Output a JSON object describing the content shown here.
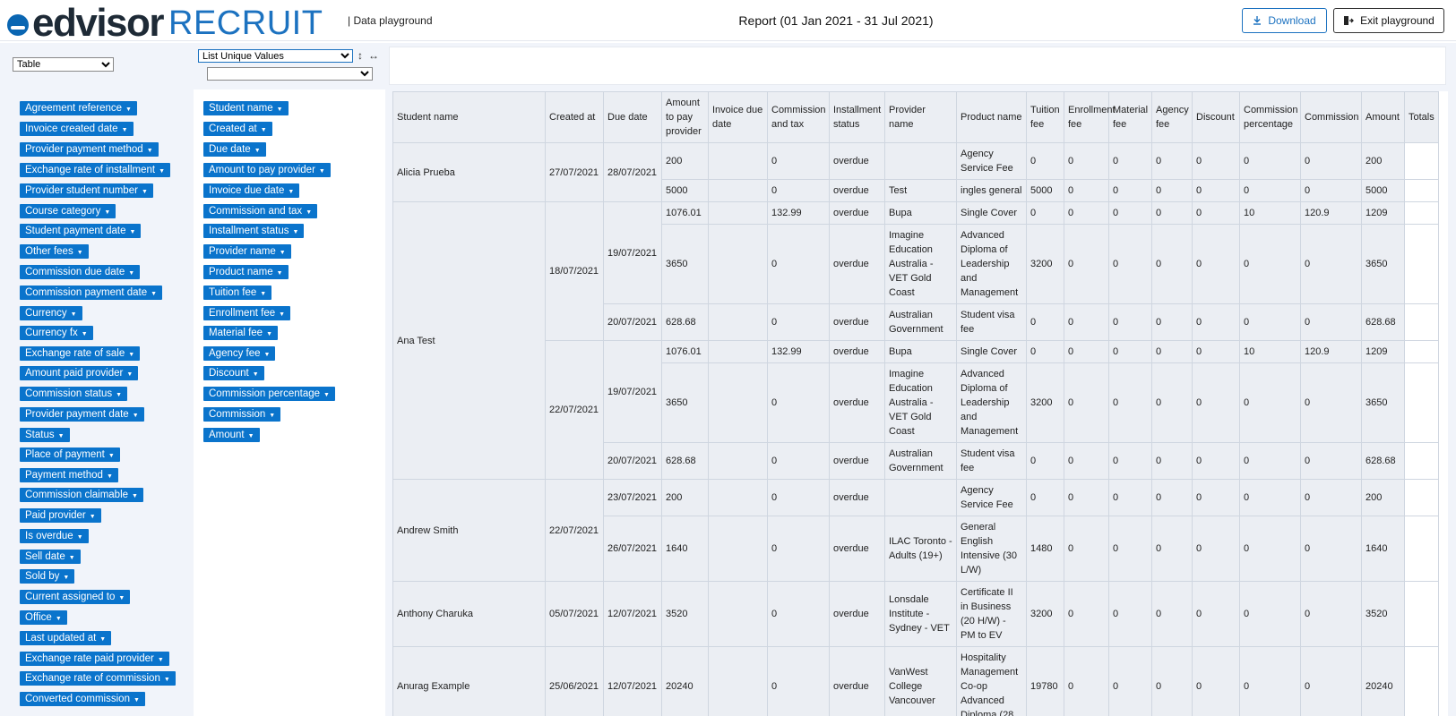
{
  "header": {
    "logo_word": "edvisor",
    "logo_recruit": "RECRUIT",
    "subtitle": "| Data playground",
    "report_title": "Report (01 Jan 2021 - 31 Jul 2021)",
    "download_label": "Download",
    "exit_label": "Exit playground"
  },
  "controls": {
    "renderer": "Table",
    "aggregator": "List Unique Values",
    "attribute": "",
    "sort_rows_icon": "↕",
    "sort_cols_icon": "↔"
  },
  "unused_attributes": [
    "Agreement reference",
    "Invoice created date",
    "Provider payment method",
    "Exchange rate of installment",
    "Provider student number",
    "Course category",
    "Student payment date",
    "Other fees",
    "Commission due date",
    "Commission payment date",
    "Currency",
    "Currency fx",
    "Exchange rate of sale",
    "Amount paid provider",
    "Commission status",
    "Provider payment date",
    "Status",
    "Place of payment",
    "Payment method",
    "Commission claimable",
    "Paid provider",
    "Is overdue",
    "Sell date",
    "Sold by",
    "Current assigned to",
    "Office",
    "Last updated at",
    "Exchange rate paid provider",
    "Exchange rate of commission",
    "Converted commission"
  ],
  "row_attributes": [
    "Student name",
    "Created at",
    "Due date",
    "Amount to pay provider",
    "Invoice due date",
    "Commission and tax",
    "Installment status",
    "Provider name",
    "Product name",
    "Tuition fee",
    "Enrollment fee",
    "Material fee",
    "Agency fee",
    "Discount",
    "Commission percentage",
    "Commission",
    "Amount"
  ],
  "table": {
    "headers": [
      "Student name",
      "Created at",
      "Due date",
      "Amount to pay provider",
      "Invoice due date",
      "Commission and tax",
      "Installment status",
      "Provider name",
      "Product name",
      "Tuition fee",
      "Enrollment fee",
      "Material fee",
      "Agency fee",
      "Discount",
      "Commission percentage",
      "Commission",
      "Amount",
      "Totals"
    ],
    "students": [
      {
        "name": "Alicia Prueba",
        "groups": [
          {
            "created": "27/07/2021",
            "dues": [
              {
                "due": "28/07/2021",
                "rows": [
                  [
                    "200",
                    "",
                    "0",
                    "overdue",
                    "",
                    "Agency Service Fee",
                    "0",
                    "0",
                    "0",
                    "0",
                    "0",
                    "0",
                    "0",
                    "200"
                  ],
                  [
                    "5000",
                    "",
                    "0",
                    "overdue",
                    "Test",
                    "ingles general",
                    "5000",
                    "0",
                    "0",
                    "0",
                    "0",
                    "0",
                    "0",
                    "5000"
                  ]
                ]
              }
            ]
          }
        ]
      },
      {
        "name": "Ana Test",
        "groups": [
          {
            "created": "18/07/2021",
            "dues": [
              {
                "due": "19/07/2021",
                "rows": [
                  [
                    "1076.01",
                    "",
                    "132.99",
                    "overdue",
                    "Bupa",
                    "Single Cover",
                    "0",
                    "0",
                    "0",
                    "0",
                    "0",
                    "10",
                    "120.9",
                    "1209"
                  ],
                  [
                    "3650",
                    "",
                    "0",
                    "overdue",
                    "Imagine Education Australia - VET Gold Coast",
                    "Advanced Diploma of Leadership and Management",
                    "3200",
                    "0",
                    "0",
                    "0",
                    "0",
                    "0",
                    "0",
                    "3650"
                  ]
                ]
              },
              {
                "due": "20/07/2021",
                "rows": [
                  [
                    "628.68",
                    "",
                    "0",
                    "overdue",
                    "Australian Government",
                    "Student visa fee",
                    "0",
                    "0",
                    "0",
                    "0",
                    "0",
                    "0",
                    "0",
                    "628.68"
                  ]
                ]
              }
            ]
          },
          {
            "created": "22/07/2021",
            "dues": [
              {
                "due": "19/07/2021",
                "rows": [
                  [
                    "1076.01",
                    "",
                    "132.99",
                    "overdue",
                    "Bupa",
                    "Single Cover",
                    "0",
                    "0",
                    "0",
                    "0",
                    "0",
                    "10",
                    "120.9",
                    "1209"
                  ],
                  [
                    "3650",
                    "",
                    "0",
                    "overdue",
                    "Imagine Education Australia - VET Gold Coast",
                    "Advanced Diploma of Leadership and Management",
                    "3200",
                    "0",
                    "0",
                    "0",
                    "0",
                    "0",
                    "0",
                    "3650"
                  ]
                ]
              },
              {
                "due": "20/07/2021",
                "rows": [
                  [
                    "628.68",
                    "",
                    "0",
                    "overdue",
                    "Australian Government",
                    "Student visa fee",
                    "0",
                    "0",
                    "0",
                    "0",
                    "0",
                    "0",
                    "0",
                    "628.68"
                  ]
                ]
              }
            ]
          }
        ]
      },
      {
        "name": "Andrew Smith",
        "groups": [
          {
            "created": "22/07/2021",
            "dues": [
              {
                "due": "23/07/2021",
                "rows": [
                  [
                    "200",
                    "",
                    "0",
                    "overdue",
                    "",
                    "Agency Service Fee",
                    "0",
                    "0",
                    "0",
                    "0",
                    "0",
                    "0",
                    "0",
                    "200"
                  ]
                ]
              },
              {
                "due": "26/07/2021",
                "rows": [
                  [
                    "1640",
                    "",
                    "0",
                    "overdue",
                    "ILAC Toronto - Adults (19+)",
                    "General English Intensive (30 L/W)",
                    "1480",
                    "0",
                    "0",
                    "0",
                    "0",
                    "0",
                    "0",
                    "1640"
                  ]
                ]
              }
            ]
          }
        ]
      },
      {
        "name": "Anthony Charuka",
        "groups": [
          {
            "created": "05/07/2021",
            "dues": [
              {
                "due": "12/07/2021",
                "rows": [
                  [
                    "3520",
                    "",
                    "0",
                    "overdue",
                    "Lonsdale Institute - Sydney - VET",
                    "Certificate II in Business (20 H/W) - PM to EV",
                    "3200",
                    "0",
                    "0",
                    "0",
                    "0",
                    "0",
                    "0",
                    "3520"
                  ]
                ]
              }
            ]
          }
        ]
      },
      {
        "name": "Anurag Example",
        "groups": [
          {
            "created": "25/06/2021",
            "dues": [
              {
                "due": "12/07/2021",
                "rows": [
                  [
                    "20240",
                    "",
                    "0",
                    "overdue",
                    "VanWest College Vancouver",
                    "Hospitality Management Co-op Advanced Diploma (28",
                    "19780",
                    "0",
                    "0",
                    "0",
                    "0",
                    "0",
                    "0",
                    "20240"
                  ]
                ]
              }
            ]
          }
        ]
      }
    ]
  }
}
